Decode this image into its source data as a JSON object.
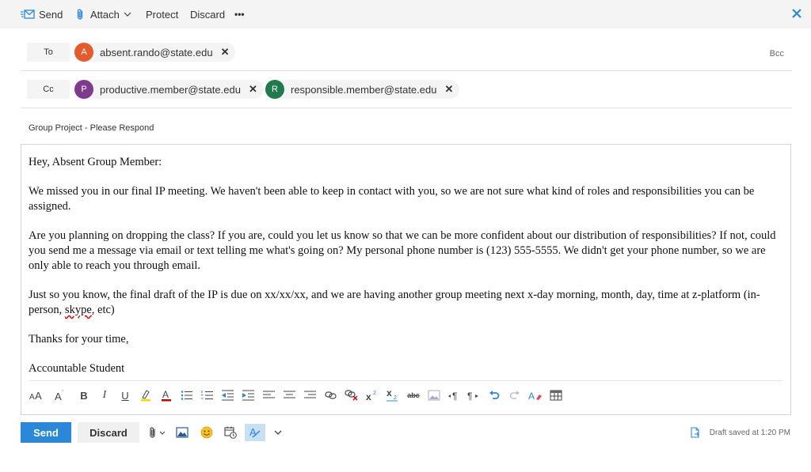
{
  "toolbar": {
    "send_label": "Send",
    "attach_label": "Attach",
    "protect_label": "Protect",
    "discard_label": "Discard",
    "more_label": "•••"
  },
  "recipients": {
    "to_label": "To",
    "to": [
      {
        "initial": "A",
        "email": "absent.rando@state.edu",
        "color": "#e25c2d"
      }
    ],
    "cc_label": "Cc",
    "cc": [
      {
        "initial": "P",
        "email": "productive.member@state.edu",
        "color": "#7e3a8c"
      },
      {
        "initial": "R",
        "email": "responsible.member@state.edu",
        "color": "#1f7a4d"
      }
    ],
    "bcc_label": "Bcc",
    "remove_glyph": "✕"
  },
  "subject": "Group Project - Please Respond",
  "message": {
    "greeting": "Hey, Absent Group Member:",
    "p1": "We missed you in our final IP meeting. We haven't been able to keep in contact with you, so we are not sure what kind of roles and responsibilities you can be assigned.",
    "p2": "Are you planning on dropping the class? If you are, could you let us know so that we can be more confident about our distribution of responsibilities? If not, could you send me a message via email or text telling me what's going on? My personal phone number is (123) 555-5555. We didn't get your phone number, so we are only able to reach you through email.",
    "p3_before": "Just so you know, the final draft of the IP is due on xx/xx/xx, and we are having another group meeting next x-day morning, month, day, time at z-platform (in-person, ",
    "p3_misspelled": "skype",
    "p3_after": ", etc)",
    "thanks": "Thanks for your time,",
    "signature": "Accountable Student"
  },
  "format_toolbar": [
    "font-size-icon",
    "grow-font-icon",
    "bold-icon",
    "italic-icon",
    "underline-icon",
    "highlight-icon",
    "font-color-icon",
    "bullets-icon",
    "numbering-icon",
    "decrease-indent-icon",
    "increase-indent-icon",
    "align-left-icon",
    "align-center-icon",
    "align-right-icon",
    "insert-link-icon",
    "remove-link-icon",
    "superscript-icon",
    "subscript-icon",
    "strikethrough-icon",
    "insert-picture-icon",
    "ltr-icon",
    "rtl-icon",
    "undo-icon",
    "redo-icon",
    "clear-formatting-icon",
    "insert-table-icon"
  ],
  "format_glyphs": {
    "bold": "B",
    "italic": "I",
    "underline": "U",
    "strike": "abc"
  },
  "actions": {
    "send_label": "Send",
    "discard_label": "Discard"
  },
  "status": {
    "draft_saved": "Draft saved at 1:20 PM"
  },
  "colors": {
    "accent": "#2b88d8",
    "font_color_red": "#d00000",
    "highlight_yellow": "#ffd700"
  }
}
